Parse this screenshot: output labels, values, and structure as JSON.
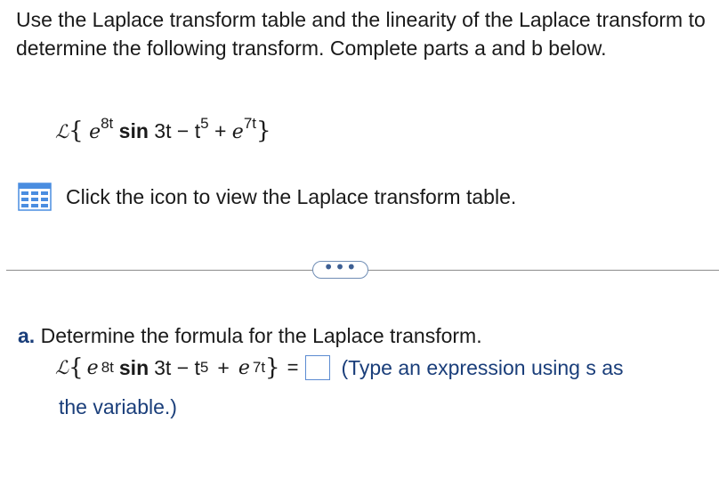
{
  "question": {
    "intro": "Use the Laplace transform table and the linearity of the Laplace transform to determine the following transform. Complete parts a and b below."
  },
  "expression": {
    "operator": "ℒ",
    "open_brace": "{",
    "e1": "e",
    "exp1": "8t",
    "function": "sin",
    "arg": "3t − t",
    "power": "5",
    "plus": "+",
    "e2": "e",
    "exp2": "7t",
    "close_brace": "}"
  },
  "table_link": {
    "text": "Click the icon to view the Laplace transform table.",
    "icon": "table-grid-icon",
    "icon_color": "#4a8de0"
  },
  "divider": {
    "button_label": "•••"
  },
  "part_a": {
    "letter": "a.",
    "text": "Determine the formula for the Laplace transform.",
    "equals": "=",
    "answer_value": "",
    "hint_line1": "(Type an expression using s as",
    "hint_line2": "the variable.)"
  },
  "colors": {
    "text": "#1a1a1a",
    "hint": "#1a3e7a",
    "box_border": "#5b8bd1",
    "divider": "#8c8c8c"
  }
}
